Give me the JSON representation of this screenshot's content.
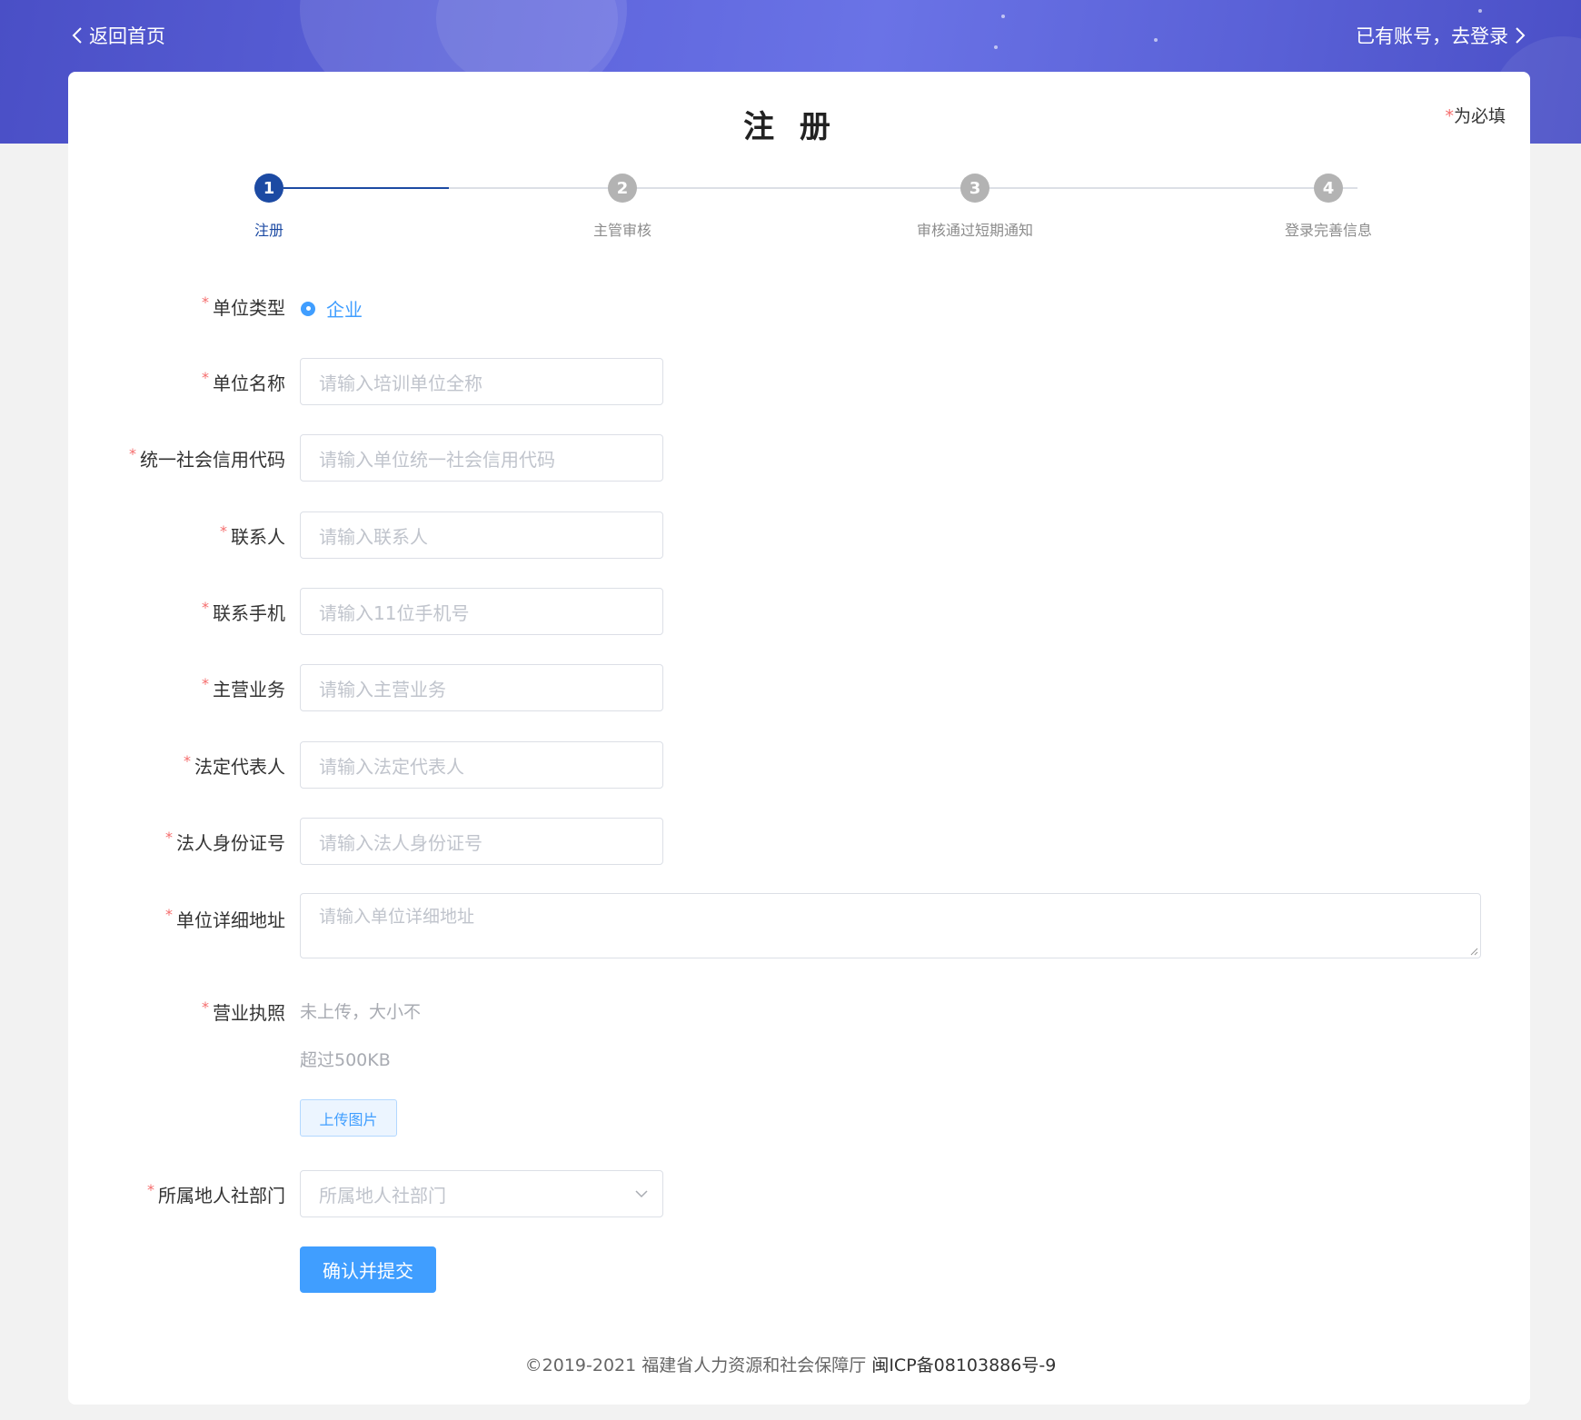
{
  "nav": {
    "back_label": "返回首页",
    "login_label": "已有账号，去登录"
  },
  "title": "注 册",
  "required_note": {
    "star": "*",
    "text": "为必填"
  },
  "steps": [
    {
      "number": "1",
      "label": "注册",
      "active": true
    },
    {
      "number": "2",
      "label": "主管审核",
      "active": false
    },
    {
      "number": "3",
      "label": "审核通过短期通知",
      "active": false
    },
    {
      "number": "4",
      "label": "登录完善信息",
      "active": false
    }
  ],
  "form": {
    "required_mark": "*",
    "unit_type": {
      "label": "单位类型",
      "option": "企业"
    },
    "unit_name": {
      "label": "单位名称",
      "placeholder": "请输入培训单位全称"
    },
    "credit_code": {
      "label": "统一社会信用代码",
      "placeholder": "请输入单位统一社会信用代码"
    },
    "contact": {
      "label": "联系人",
      "placeholder": "请输入联系人"
    },
    "phone": {
      "label": "联系手机",
      "placeholder": "请输入11位手机号"
    },
    "business": {
      "label": "主营业务",
      "placeholder": "请输入主营业务"
    },
    "legal_rep": {
      "label": "法定代表人",
      "placeholder": "请输入法定代表人"
    },
    "legal_id": {
      "label": "法人身份证号",
      "placeholder": "请输入法人身份证号"
    },
    "address": {
      "label": "单位详细地址",
      "placeholder": "请输入单位详细地址"
    },
    "license": {
      "label": "营业执照",
      "hint_line1": "未上传，大小不",
      "hint_line2": "超过500KB",
      "upload_label": "上传图片"
    },
    "department": {
      "label": "所属地人社部门",
      "placeholder": "所属地人社部门"
    },
    "submit_label": "确认并提交"
  },
  "footer": {
    "copyright": "©2019-2021 福建省人力资源和社会保障厅",
    "icp": "闽ICP备08103886号-9"
  },
  "colors": {
    "banner": "#5f66dd",
    "step_active": "#1c4aa3",
    "primary": "#409eff",
    "required": "#f56c6c"
  }
}
